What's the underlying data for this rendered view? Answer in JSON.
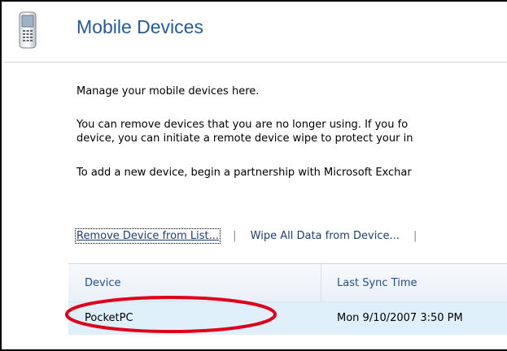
{
  "header": {
    "title": "Mobile Devices",
    "icon": "mobile-phone-icon"
  },
  "content": {
    "intro": "Manage your mobile devices here.",
    "remove_line1": "You can remove devices that you are no longer using. If you fo",
    "remove_line2": "device, you can initiate a remote device wipe to protect your in",
    "add_device": "To add a new device, begin a partnership with Microsoft Exchar"
  },
  "actions": {
    "remove_label": "Remove Device from List...",
    "wipe_label": "Wipe All Data from Device..."
  },
  "table": {
    "columns": [
      "Device",
      "Last Sync Time"
    ],
    "rows": [
      {
        "device": "PocketPC",
        "last_sync": "Mon 9/10/2007 3:50 PM"
      }
    ]
  },
  "colors": {
    "title": "#1f5c9e",
    "header_text": "#1f4f8f",
    "selected_row": "#dff0fb",
    "annotation": "#e0001a"
  }
}
